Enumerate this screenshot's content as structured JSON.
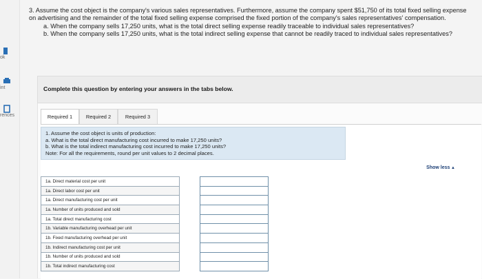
{
  "sidebar": {
    "items": [
      {
        "label": "ok",
        "icon": "book-icon"
      },
      {
        "label": "int",
        "icon": "print-icon"
      },
      {
        "label": "rences",
        "icon": "references-icon"
      }
    ]
  },
  "question": {
    "intro": "3. Assume the cost object is the company's various sales representatives. Furthermore, assume the company spent $51,750 of its total fixed selling expense on advertising and the remainder of the total fixed selling expense comprised the fixed portion of the company's sales representatives' compensation.",
    "part_a": "a. When the company sells 17,250 units, what is the total direct selling expense readily traceable to individual sales representatives?",
    "part_b": "b. When the company sells 17,250 units, what is the total indirect selling expense that cannot be readily traced to individual sales representatives?"
  },
  "complete_prompt": "Complete this question by entering your answers in the tabs below.",
  "tabs": [
    {
      "label": "Required 1",
      "active": true
    },
    {
      "label": "Required 2",
      "active": false
    },
    {
      "label": "Required 3",
      "active": false
    }
  ],
  "instructions": {
    "line1": "1. Assume the cost object is units of production:",
    "line2": "a. What is the total direct manufacturing cost incurred to make 17,250 units?",
    "line3": "b. What is the total indirect manufacturing cost incurred to make 17,250 units?",
    "line4": "Note: For all the requirements, round per unit values to 2 decimal places."
  },
  "show_less": "Show less",
  "rows": [
    {
      "label": "1a. Direct material cost per unit",
      "value": ""
    },
    {
      "label": "1a. Direct labor cost per unit",
      "value": ""
    },
    {
      "label": "1a. Direct manufacturing cost per unit",
      "value": ""
    },
    {
      "label": "1a. Number of units produced and sold",
      "value": ""
    },
    {
      "label": "1a. Total direct manufacturing cost",
      "value": ""
    },
    {
      "label": "1b. Variable manufacturing overhead per unit",
      "value": ""
    },
    {
      "label": "1b. Fixed manufacturing overhead per unit",
      "value": ""
    },
    {
      "label": "1b. Indirect manufacturing cost per unit",
      "value": ""
    },
    {
      "label": "1b. Number of units produced and sold",
      "value": ""
    },
    {
      "label": "1b. Total indirect manufacturing cost",
      "value": ""
    }
  ],
  "colors": {
    "instr_bg": "#dbe8f3",
    "accent": "#1c3f76",
    "input_border": "#6e8fa8"
  }
}
